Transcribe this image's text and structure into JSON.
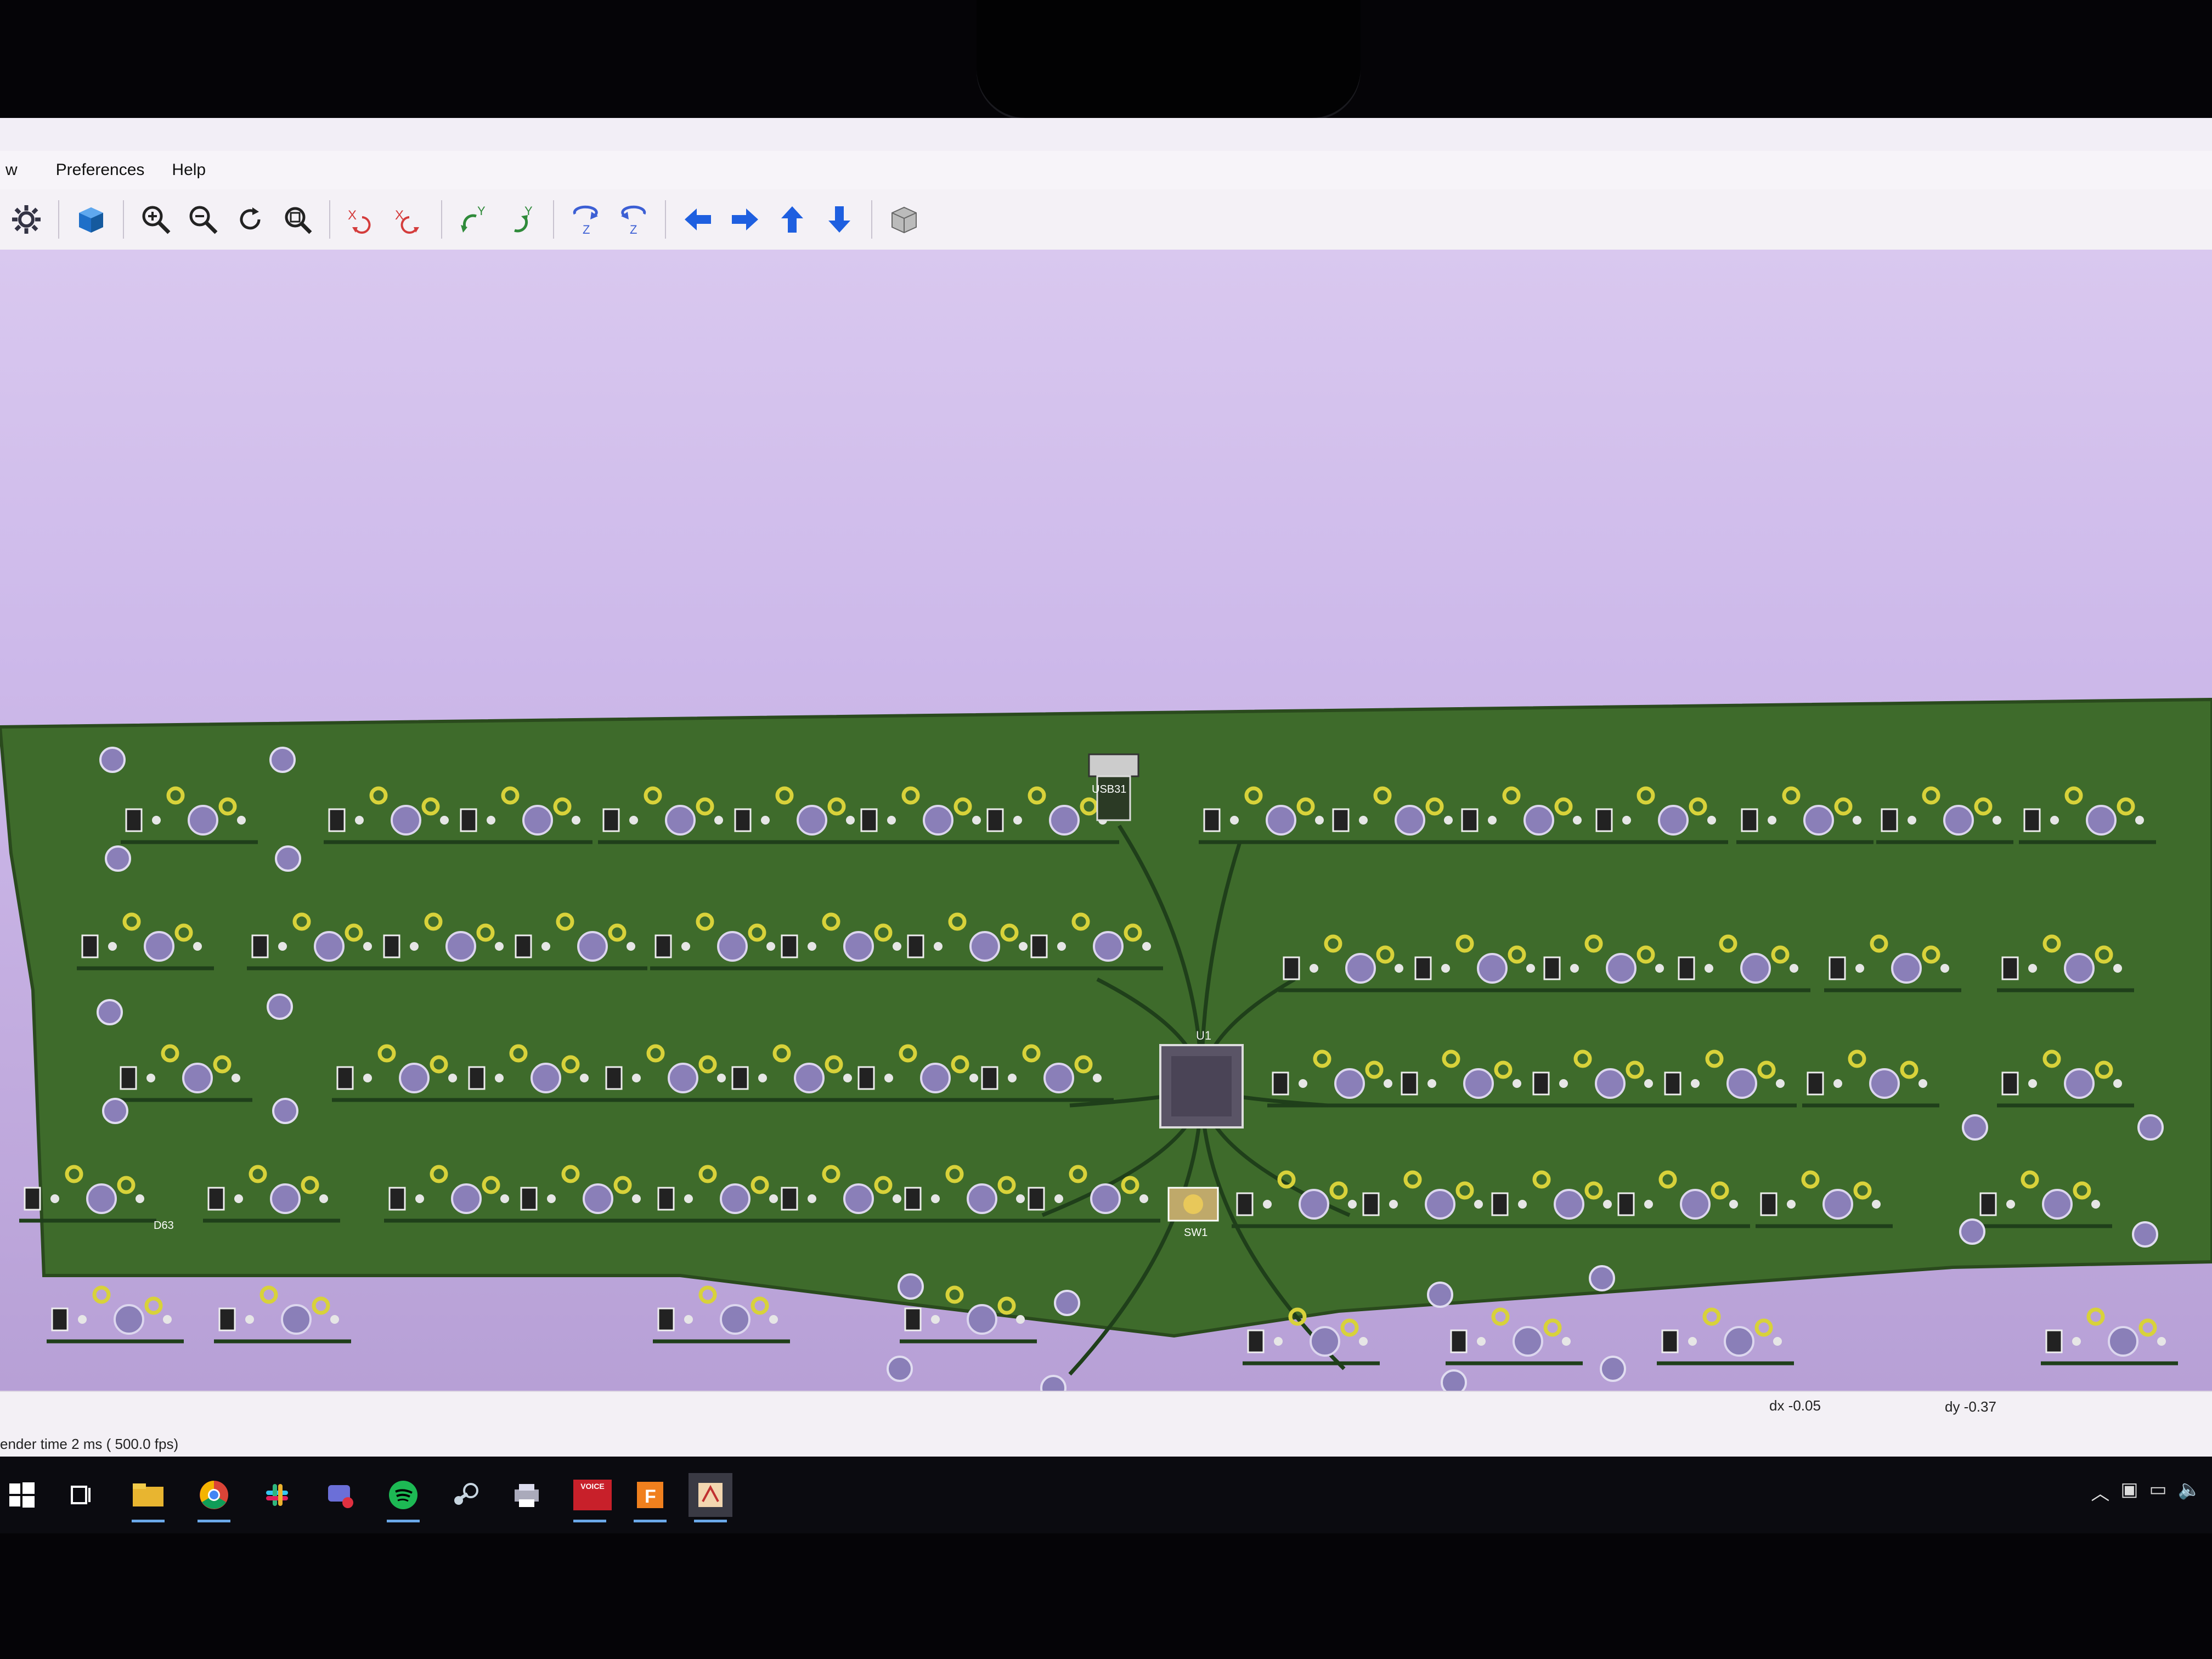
{
  "menu": {
    "items": [
      "w",
      "Preferences",
      "Help"
    ]
  },
  "toolbar": {
    "buttons": [
      {
        "name": "settings-icon"
      },
      {
        "name": "3d-box-icon"
      },
      {
        "name": "zoom-in-icon"
      },
      {
        "name": "zoom-out-icon"
      },
      {
        "name": "redraw-icon"
      },
      {
        "name": "zoom-fit-icon"
      },
      {
        "name": "rotate-x-cw-icon"
      },
      {
        "name": "rotate-x-ccw-icon"
      },
      {
        "name": "rotate-y-cw-icon"
      },
      {
        "name": "rotate-y-ccw-icon"
      },
      {
        "name": "rotate-z-cw-icon"
      },
      {
        "name": "rotate-z-ccw-icon"
      },
      {
        "name": "pan-left-icon"
      },
      {
        "name": "pan-right-icon"
      },
      {
        "name": "pan-up-icon"
      },
      {
        "name": "pan-down-icon"
      },
      {
        "name": "ortho-toggle-icon"
      }
    ],
    "icon_colors": {
      "rotate_x": "#d43c3c",
      "rotate_y": "#2f8a3a",
      "rotate_z": "#3c5fd4",
      "pan": "#1e5fe0"
    }
  },
  "pcb": {
    "board_color": "#3e6b2b",
    "pad_color": "#d8d23a",
    "hole_color": "#8a7fb8",
    "track_color": "#1f3f1a",
    "labels": {
      "usb": "USB31",
      "mcu": "U1",
      "switch": "SW1",
      "diode_bottom_left": "D63"
    }
  },
  "status": {
    "render_time": "ender time 2 ms ( 500.0 fps)",
    "dx": "dx -0.05",
    "dy": "dy -0.37"
  },
  "taskbar": {
    "items": [
      {
        "name": "windows-start-icon"
      },
      {
        "name": "task-view-icon"
      },
      {
        "name": "file-explorer-icon"
      },
      {
        "name": "chrome-icon"
      },
      {
        "name": "slack-icon"
      },
      {
        "name": "chat-icon"
      },
      {
        "name": "spotify-icon"
      },
      {
        "name": "steam-icon"
      },
      {
        "name": "printer-app-icon"
      },
      {
        "name": "voice-app-icon"
      },
      {
        "name": "fusion-icon"
      },
      {
        "name": "kicad-3d-viewer-icon"
      }
    ],
    "voice_label": "VOICE"
  }
}
